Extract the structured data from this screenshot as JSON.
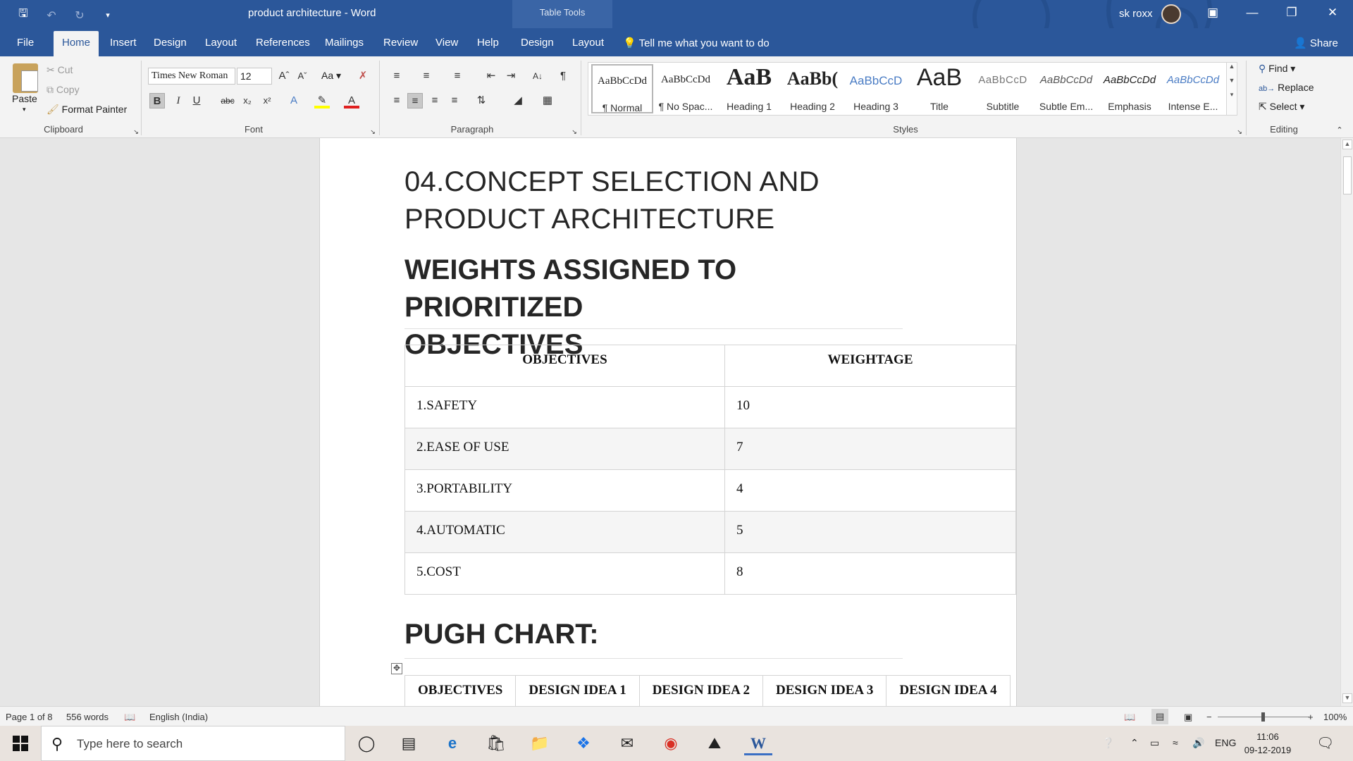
{
  "window": {
    "title": "product architecture  -  Word",
    "contextual_tab_group": "Table Tools",
    "user_name": "sk roxx"
  },
  "ribbon_tabs": [
    "File",
    "Home",
    "Insert",
    "Design",
    "Layout",
    "References",
    "Mailings",
    "Review",
    "View",
    "Help",
    "Design",
    "Layout"
  ],
  "tell_me": "Tell me what you want to do",
  "share": "Share",
  "clipboard": {
    "paste": "Paste",
    "cut": "Cut",
    "copy": "Copy",
    "format_painter": "Format Painter",
    "group_label": "Clipboard"
  },
  "font": {
    "name": "Times New Roman",
    "size": "12",
    "case_label": "Aa",
    "group_label": "Font"
  },
  "paragraph": {
    "group_label": "Paragraph"
  },
  "styles": {
    "group_label": "Styles",
    "items": [
      {
        "sample": "AaBbCcDd",
        "name": "¶ Normal"
      },
      {
        "sample": "AaBbCcDd",
        "name": "¶ No Spac..."
      },
      {
        "sample": "AaB",
        "name": "Heading 1"
      },
      {
        "sample": "AaBb(",
        "name": "Heading 2"
      },
      {
        "sample": "AaBbCcD",
        "name": "Heading 3"
      },
      {
        "sample": "AaB",
        "name": "Title"
      },
      {
        "sample": "AaBbCcD",
        "name": "Subtitle"
      },
      {
        "sample": "AaBbCcDd",
        "name": "Subtle Em..."
      },
      {
        "sample": "AaBbCcDd",
        "name": "Emphasis"
      },
      {
        "sample": "AaBbCcDd",
        "name": "Intense E..."
      }
    ]
  },
  "editing": {
    "group_label": "Editing",
    "find": "Find",
    "replace": "Replace",
    "select": "Select"
  },
  "document": {
    "heading_line1": "04.CONCEPT SELECTION AND",
    "heading_line2": "PRODUCT ARCHITECTURE",
    "weights_line1": "WEIGHTS ASSIGNED TO PRIORITIZED",
    "weights_line2": "OBJECTIVES",
    "weights_table": {
      "headers": [
        "OBJECTIVES",
        "WEIGHTAGE"
      ],
      "rows": [
        [
          "1.SAFETY",
          "10"
        ],
        [
          "2.EASE OF USE",
          "7"
        ],
        [
          "3.PORTABILITY",
          "4"
        ],
        [
          "4.AUTOMATIC",
          "5"
        ],
        [
          "5.COST",
          "8"
        ]
      ]
    },
    "pugh_heading": "PUGH CHART:",
    "pugh_headers": [
      "OBJECTIVES",
      "DESIGN IDEA 1",
      "DESIGN IDEA 2",
      "DESIGN IDEA 3",
      "DESIGN IDEA 4"
    ]
  },
  "status": {
    "page": "Page 1 of 8",
    "words": "556 words",
    "language": "English (India)",
    "zoom": "100%"
  },
  "taskbar": {
    "search_placeholder": "Type here to search",
    "language": "ENG",
    "time": "11:06",
    "date": "09-12-2019"
  },
  "colors": {
    "title_bar": "#2b579a",
    "ribbon": "#f3f3f3",
    "canvas": "#e6e6e6"
  }
}
